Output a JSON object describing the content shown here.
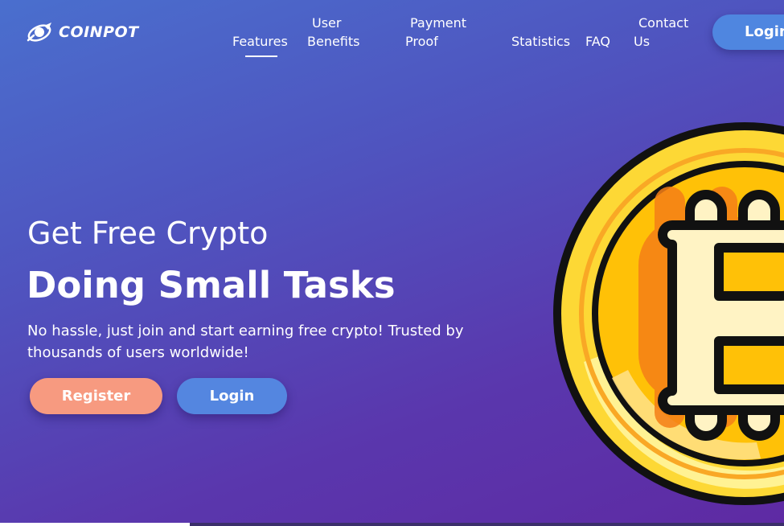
{
  "brand": {
    "name": "COINPOT"
  },
  "nav": {
    "items": [
      {
        "lines": [
          "Features"
        ]
      },
      {
        "lines": [
          "User",
          "Benefits"
        ]
      },
      {
        "lines": [
          "Payment",
          "Proof"
        ]
      },
      {
        "lines": [
          "Statistics"
        ]
      },
      {
        "lines": [
          "FAQ"
        ]
      },
      {
        "lines": [
          "Contact",
          "Us"
        ]
      }
    ],
    "login_label": "Login"
  },
  "hero": {
    "line1": "Get Free Crypto",
    "line2": "Doing Small Tasks",
    "description": "No hassle, just join and start earning free crypto! Trusted by thousands of users worldwide!",
    "register_label": "Register",
    "login_label": "Login"
  },
  "colors": {
    "gradient_start": "#4a6fce",
    "gradient_end": "#5e2aa3",
    "register_button": "#f79a80",
    "login_button": "#5486e0",
    "coin_gold": "#fbc02d",
    "coin_outline": "#000000"
  },
  "icons": {
    "logo": "rocket-coin-icon",
    "coin": "bitcoin-coin-icon"
  }
}
